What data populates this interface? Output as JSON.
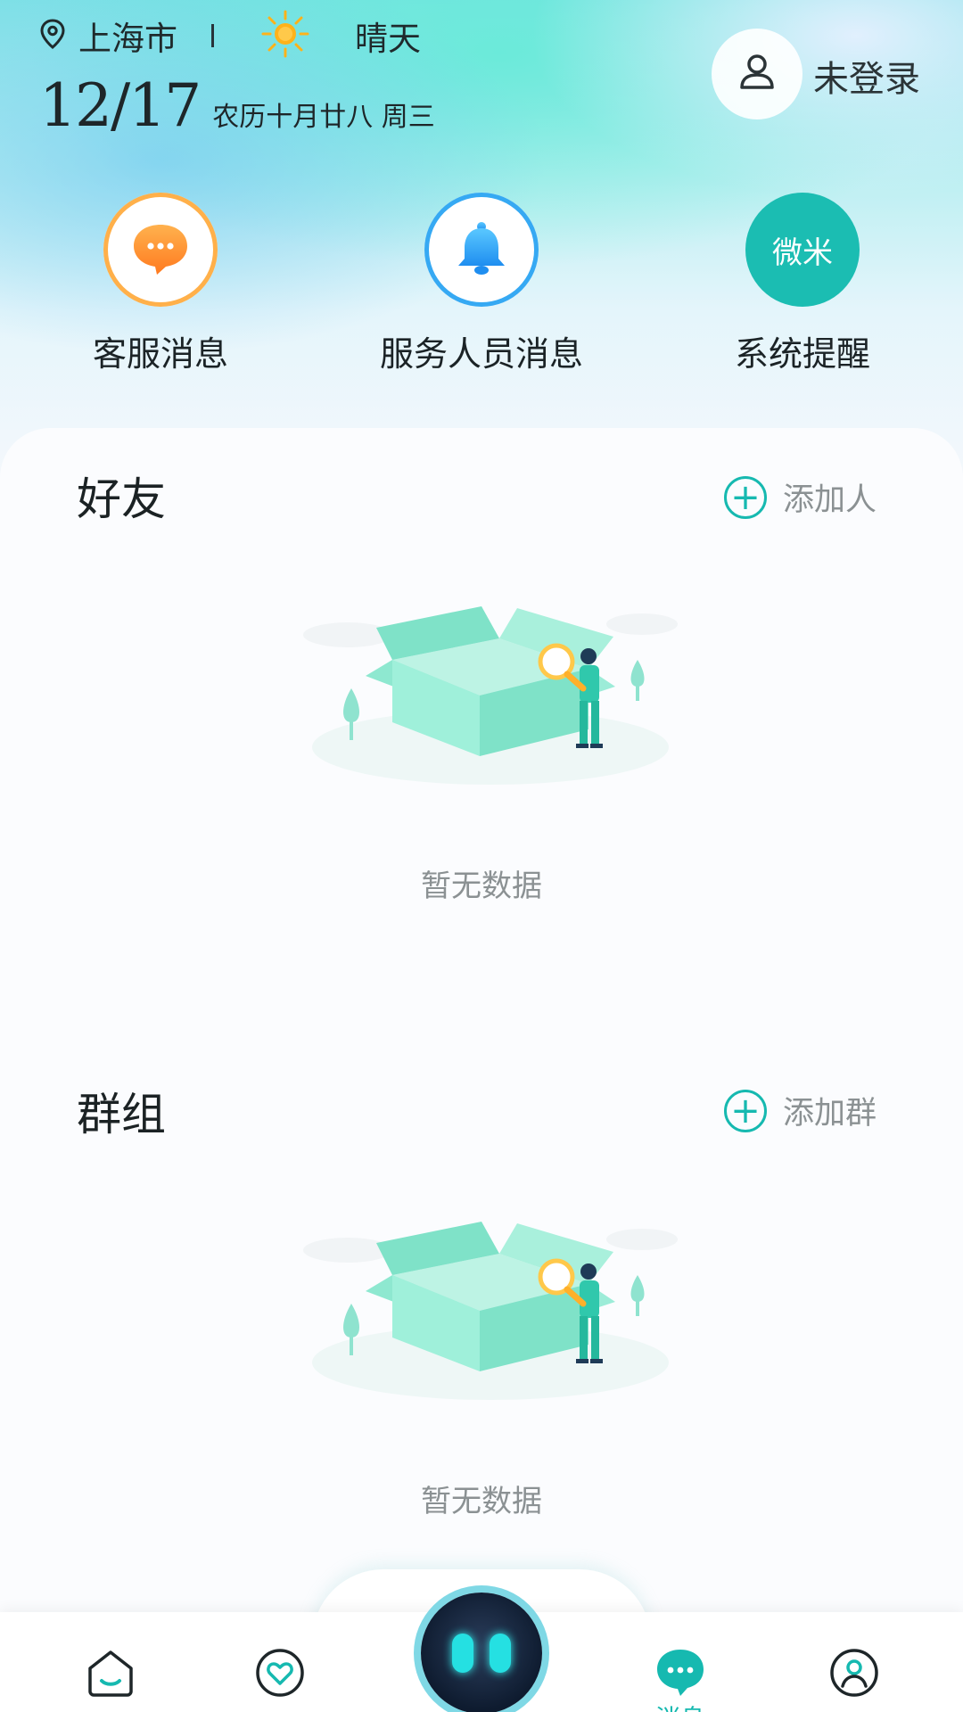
{
  "header": {
    "city": "上海市",
    "weather": "晴天",
    "date": "12/17",
    "lunar_date": "农历十月廿八  周三",
    "login_status": "未登录"
  },
  "shortcuts": [
    {
      "label": "客服消息",
      "icon": "chat-bubble-icon"
    },
    {
      "label": "服务人员消息",
      "icon": "bell-icon"
    },
    {
      "label": "系统提醒",
      "icon": "weimi-logo",
      "badge_text": "微米"
    }
  ],
  "friends": {
    "title": "好友",
    "add_label": "添加人",
    "empty_text": "暂无数据"
  },
  "groups": {
    "title": "群组",
    "add_label": "添加群",
    "empty_text": "暂无数据"
  },
  "bottom_nav": {
    "items": [
      {
        "name": "home",
        "icon": "home-icon"
      },
      {
        "name": "health",
        "icon": "heart-icon"
      },
      {
        "name": "assistant",
        "icon": "robot-icon"
      },
      {
        "name": "messages",
        "icon": "chat-icon",
        "label": "消息",
        "active": true
      },
      {
        "name": "profile",
        "icon": "user-icon"
      }
    ]
  },
  "colors": {
    "accent": "#16b9b0",
    "orange": "#ff8a2a",
    "blue": "#2a9cf5"
  }
}
